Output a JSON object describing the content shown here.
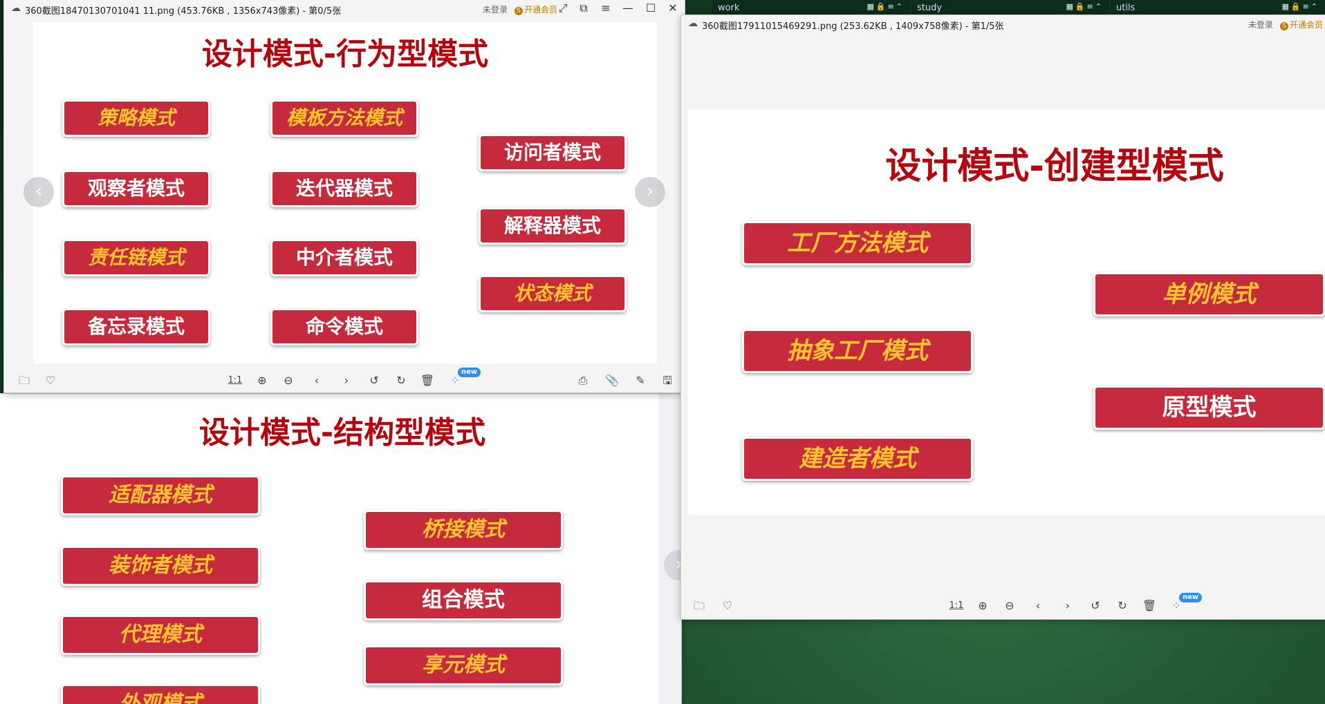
{
  "desktop": {
    "folders": [
      {
        "label": "work"
      },
      {
        "label": "study"
      },
      {
        "label": "utils"
      }
    ]
  },
  "viewer_left": {
    "title": "360截图18470130701041 11.png (453.76KB , 1356x743像素) - 第0/5张",
    "login": "未登录",
    "vip": "开通会员",
    "slide": {
      "title": "设计模式-行为型模式",
      "buttons": [
        {
          "label": "策略模式",
          "italic": true
        },
        {
          "label": "模板方法模式",
          "italic": true
        },
        {
          "label": "访问者模式",
          "italic": false
        },
        {
          "label": "观察者模式",
          "italic": false
        },
        {
          "label": "迭代器模式",
          "italic": false
        },
        {
          "label": "解释器模式",
          "italic": false
        },
        {
          "label": "责任链模式",
          "italic": true
        },
        {
          "label": "中介者模式",
          "italic": false
        },
        {
          "label": "状态模式",
          "italic": true
        },
        {
          "label": "备忘录模式",
          "italic": false
        },
        {
          "label": "命令模式",
          "italic": false
        }
      ]
    },
    "toolbar": {
      "ratio": "1:1",
      "new_badge": "new"
    }
  },
  "lower_slide": {
    "title": "设计模式-结构型模式",
    "buttons": [
      {
        "label": "适配器模式",
        "italic": true
      },
      {
        "label": "桥接模式",
        "italic": true
      },
      {
        "label": "装饰者模式",
        "italic": true
      },
      {
        "label": "组合模式",
        "italic": false
      },
      {
        "label": "代理模式",
        "italic": true
      },
      {
        "label": "享元模式",
        "italic": true
      },
      {
        "label": "外观模式",
        "italic": true
      }
    ]
  },
  "viewer_right": {
    "title": "360截图17911015469291.png (253.62KB , 1409x758像素) - 第1/5张",
    "login": "未登录",
    "vip": "开通会员",
    "slide": {
      "title": "设计模式-创建型模式",
      "buttons": [
        {
          "label": "工厂方法模式",
          "italic": true
        },
        {
          "label": "单例模式",
          "italic": true
        },
        {
          "label": "抽象工厂模式",
          "italic": true
        },
        {
          "label": "原型模式",
          "italic": false
        },
        {
          "label": "建造者模式",
          "italic": true
        }
      ]
    },
    "toolbar": {
      "ratio": "1:1",
      "new_badge": "new"
    }
  },
  "colors": {
    "accent_red": "#c52a3d",
    "title_red": "#b4060f",
    "italic_gold": "#ffc42e"
  }
}
